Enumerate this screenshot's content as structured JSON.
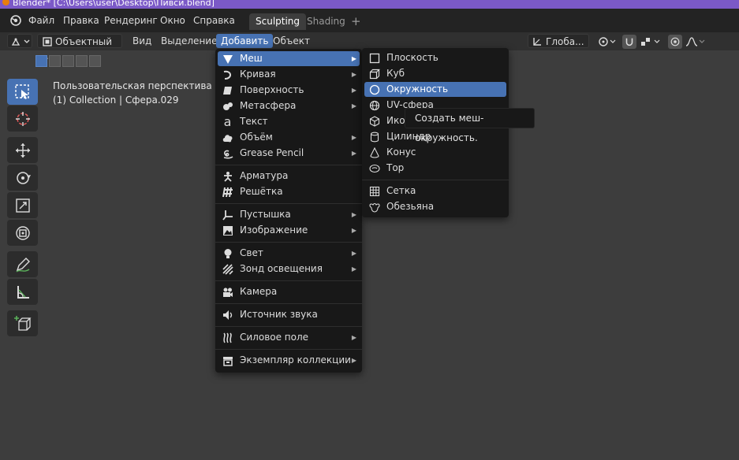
{
  "window_title": "Blender* [C:\\Users\\user\\Desktop\\Пивси.blend]",
  "topbar": {
    "menus": [
      "Файл",
      "Правка",
      "Рендеринг",
      "Окно",
      "Справка"
    ],
    "workspace_tabs": [
      {
        "label": "Sculpting",
        "active": true
      },
      {
        "label": "Shading",
        "active": false
      }
    ],
    "add_workspace": "+"
  },
  "header": {
    "mode": "Объектный ...",
    "menus": [
      "Вид",
      "Выделение",
      "Добавить",
      "Объект"
    ],
    "transform_orientation": "Глоба..."
  },
  "viewport": {
    "perspective_label": "Пользовательская перспектива",
    "collection_label": "(1) Collection | Сфера.029"
  },
  "add_menu": {
    "items": [
      {
        "label": "Меш",
        "icon": "mesh-icon",
        "submenu": true
      },
      {
        "label": "Кривая",
        "icon": "curve-icon",
        "submenu": true
      },
      {
        "label": "Поверхность",
        "icon": "surface-icon",
        "submenu": true
      },
      {
        "label": "Метасфера",
        "icon": "metaball-icon",
        "submenu": true
      },
      {
        "label": "Текст",
        "icon": "text-icon",
        "submenu": false
      },
      {
        "label": "Объём",
        "icon": "volume-icon",
        "submenu": true
      },
      {
        "label": "Grease Pencil",
        "icon": "grease-pencil-icon",
        "submenu": true
      },
      {
        "label": "Арматура",
        "icon": "armature-icon",
        "submenu": false
      },
      {
        "label": "Решётка",
        "icon": "lattice-icon",
        "submenu": false
      },
      {
        "label": "Пустышка",
        "icon": "empty-icon",
        "submenu": true
      },
      {
        "label": "Изображение",
        "icon": "image-icon",
        "submenu": true
      },
      {
        "label": "Свет",
        "icon": "light-icon",
        "submenu": true
      },
      {
        "label": "Зонд освещения",
        "icon": "light-probe-icon",
        "submenu": true
      },
      {
        "label": "Камера",
        "icon": "camera-icon",
        "submenu": false
      },
      {
        "label": "Источник звука",
        "icon": "speaker-icon",
        "submenu": false
      },
      {
        "label": "Силовое поле",
        "icon": "force-field-icon",
        "submenu": true
      },
      {
        "label": "Экземпляр коллекции",
        "icon": "collection-instance-icon",
        "submenu": true
      }
    ]
  },
  "mesh_menu": {
    "items": [
      {
        "label": "Плоскость",
        "icon": "plane-icon"
      },
      {
        "label": "Куб",
        "icon": "cube-icon"
      },
      {
        "label": "Окружность",
        "icon": "circle-icon"
      },
      {
        "label": "UV-сфера",
        "icon": "uv-sphere-icon"
      },
      {
        "label": "Икос",
        "icon": "ico-sphere-icon"
      },
      {
        "label": "Цилиндр",
        "icon": "cylinder-icon"
      },
      {
        "label": "Конус",
        "icon": "cone-icon"
      },
      {
        "label": "Тор",
        "icon": "torus-icon"
      },
      {
        "label": "Сетка",
        "icon": "grid-icon"
      },
      {
        "label": "Обезьяна",
        "icon": "monkey-icon"
      }
    ]
  },
  "tooltip": "Создать меш-окружность.",
  "colors": {
    "accent": "#4772b3",
    "background": "#3d3d3d",
    "menu_bg": "#181818",
    "title_bar": "#7b59c7"
  }
}
